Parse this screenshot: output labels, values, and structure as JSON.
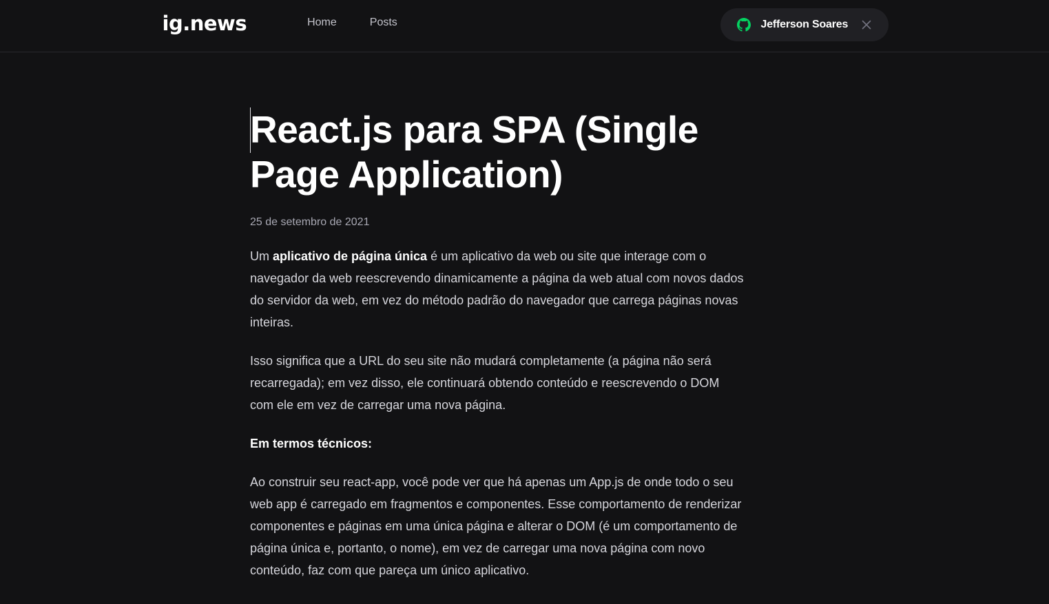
{
  "header": {
    "logo": "ig.news",
    "nav": [
      {
        "label": "Home"
      },
      {
        "label": "Posts"
      }
    ],
    "user": {
      "name": "Jefferson Soares",
      "icon": "github-icon",
      "icon_color": "#04d361",
      "close_icon": "close-icon"
    }
  },
  "post": {
    "title": "React.js para SPA (Single Page Application)",
    "date": "25 de setembro de 2021",
    "p1": {
      "before": "Um ",
      "bold": "aplicativo de página única",
      "after": " é um aplicativo da web ou site que interage com o navegador da web reescrevendo dinamicamente a página da web atual com novos dados do servidor da web, em vez do método padrão do navegador que carrega páginas novas inteiras."
    },
    "p2": "Isso significa que a URL do seu site não mudará completamente (a página não será recarregada); em vez disso, ele continuará obtendo conteúdo e reescrevendo o DOM com ele em vez de carregar uma nova página.",
    "p3": "Em termos técnicos:",
    "p4": "Ao construir seu react-app, você pode ver que há apenas um App.js de onde todo o seu web app é carregado em fragmentos e componentes. Esse comportamento de renderizar componentes e páginas em uma única página e alterar o DOM (é um comportamento de página única e, portanto, o nome), em vez de carregar uma nova página com novo conteúdo, faz com que pareça um único aplicativo."
  },
  "colors": {
    "background": "#121214",
    "header_border": "#29292e",
    "button_bg": "#202024",
    "text": "#e1e1e6",
    "muted": "#a8a8b3"
  }
}
